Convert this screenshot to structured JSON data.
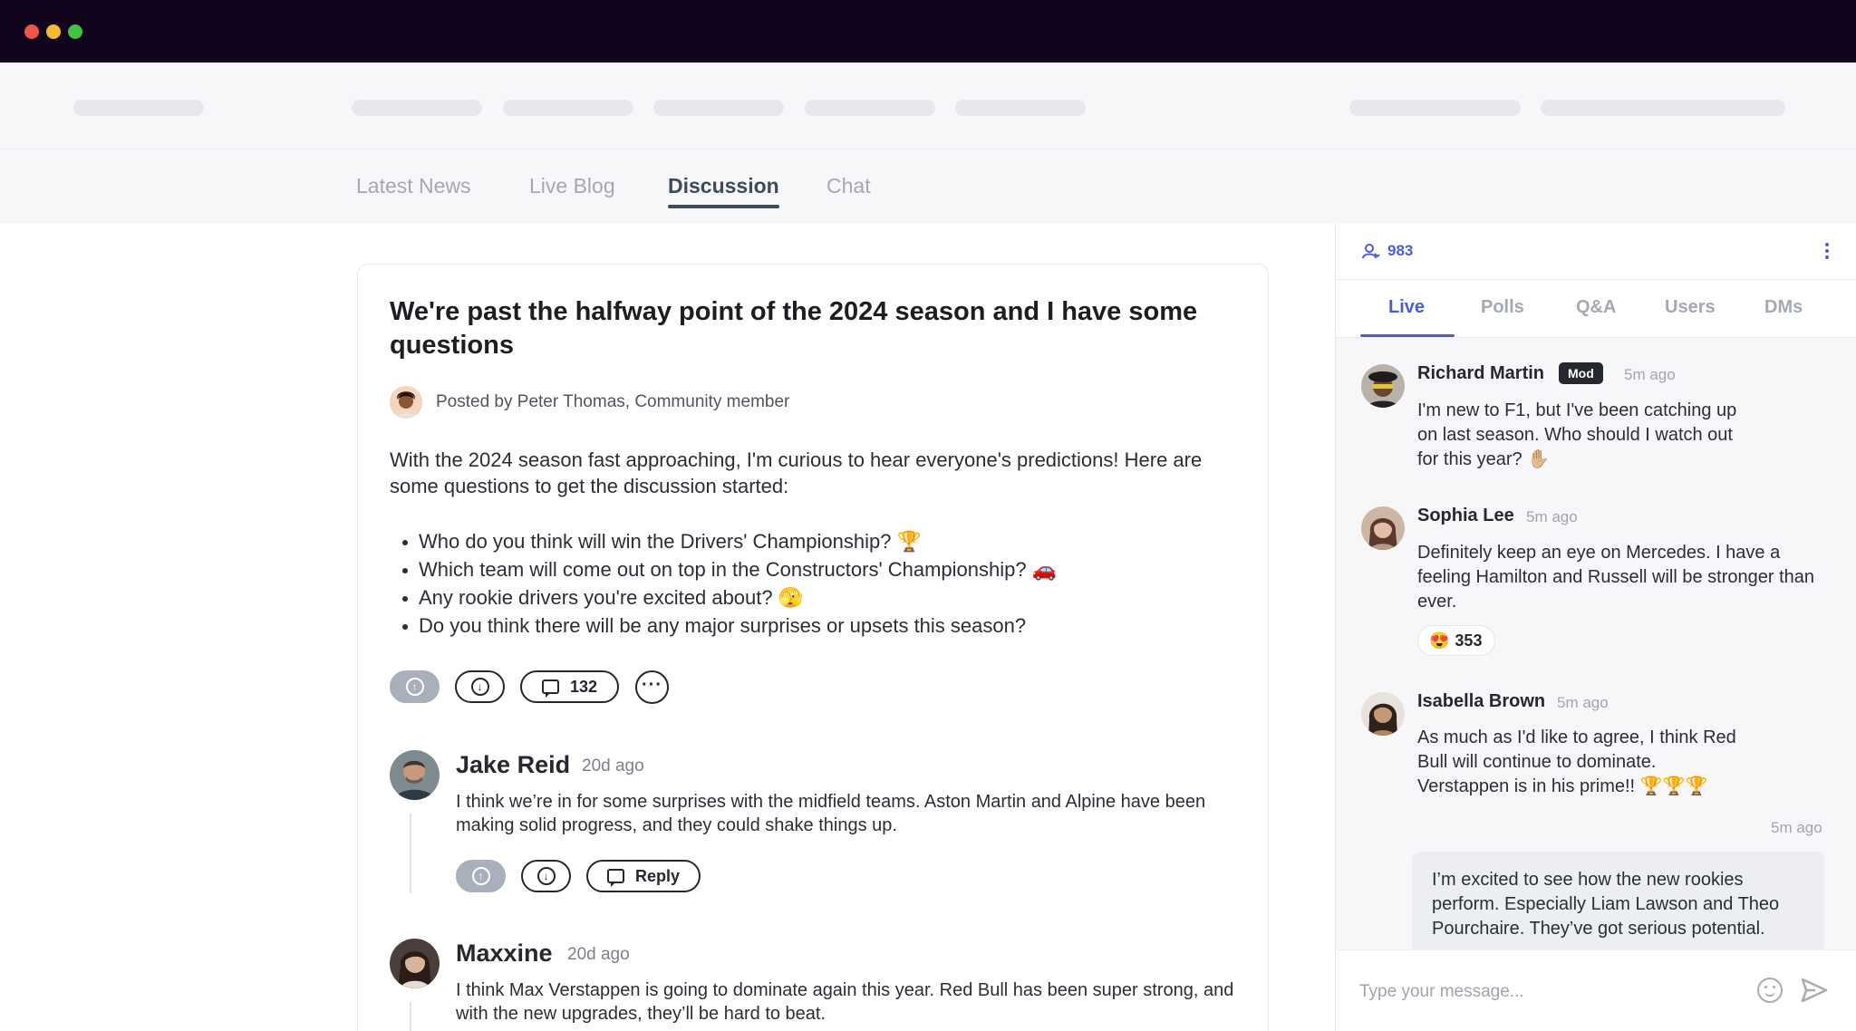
{
  "content_tabs": [
    "Latest News",
    "Live Blog",
    "Discussion",
    "Chat"
  ],
  "post": {
    "title": "We're past the halfway point of the 2024 season and I have some questions",
    "author_line": "Posted by Peter Thomas, Community member",
    "body": "With the 2024 season fast approaching, I'm curious to hear everyone's predictions! Here are some questions to get the discussion started:",
    "questions": [
      "Who do you think will win the Drivers' Championship? 🏆",
      "Which team will come out on top in the Constructors' Championship? 🚗",
      "Any rookie drivers you're excited about? 🫣",
      "Do you think there will be any major surprises or upsets this season?"
    ],
    "comment_count": "132"
  },
  "comments": [
    {
      "name": "Jake Reid",
      "time": "20d ago",
      "text": "I think we’re in for some surprises with the midfield teams. Aston Martin and Alpine have been making solid progress, and they could shake things up.",
      "reply_label": "Reply"
    },
    {
      "name": "Maxxine",
      "time": "20d ago",
      "text": "I think Max Verstappen is going to dominate again this year. Red Bull has been super strong, and with the new upgrades, they’ll be hard to beat."
    }
  ],
  "panel": {
    "user_count": "983",
    "tabs": [
      "Live",
      "Polls",
      "Q&A",
      "Users",
      "DMs"
    ],
    "active_tab": "Live",
    "accent_color": "#4f5bd5",
    "messages": [
      {
        "name": "Richard Martin",
        "badge": "Mod",
        "time": "5m ago",
        "text": "I'm new to F1, but I've been catching up on last season. Who should I watch out for this year? ✋🏼"
      },
      {
        "name": "Sophia Lee",
        "time": "5m ago",
        "text": "Definitely keep an eye on Mercedes. I have a feeling Hamilton and Russell will be stronger than ever.",
        "reaction_emoji": "😍",
        "reaction_count": "353"
      },
      {
        "name": "Isabella Brown",
        "time": "5m ago",
        "text": "As much as I'd like to agree, I think Red Bull will continue to dominate. Verstappen is in his prime!! 🏆🏆🏆"
      }
    ],
    "own_message": {
      "time": "5m ago",
      "text": "I’m excited to see how the new rookies perform. Especially Liam Lawson and Theo Pourchaire. They’ve got serious potential."
    },
    "composer_placeholder": "Type your message..."
  }
}
